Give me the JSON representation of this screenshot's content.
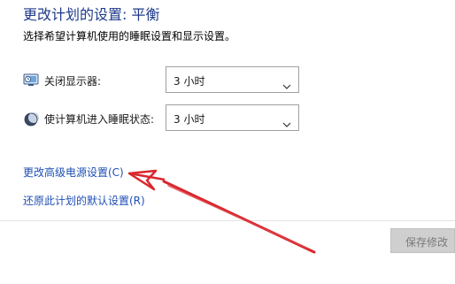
{
  "header": {
    "title": "更改计划的设置: 平衡",
    "subtitle": "选择希望计算机使用的睡眠设置和显示设置。"
  },
  "settings": [
    {
      "label": "关闭显示器:",
      "value": "3 小时",
      "icon": "monitor-icon"
    },
    {
      "label": "使计算机进入睡眠状态:",
      "value": "3 小时",
      "icon": "moon-icon"
    }
  ],
  "links": {
    "advanced": "更改高级电源设置(C)",
    "restore": "还原此计划的默认设置(R)"
  },
  "footer": {
    "save_label": "保存修改"
  },
  "colors": {
    "title": "#1e3a8a",
    "link": "#1e4fb5",
    "annotation_arrow": "#d9272e"
  }
}
